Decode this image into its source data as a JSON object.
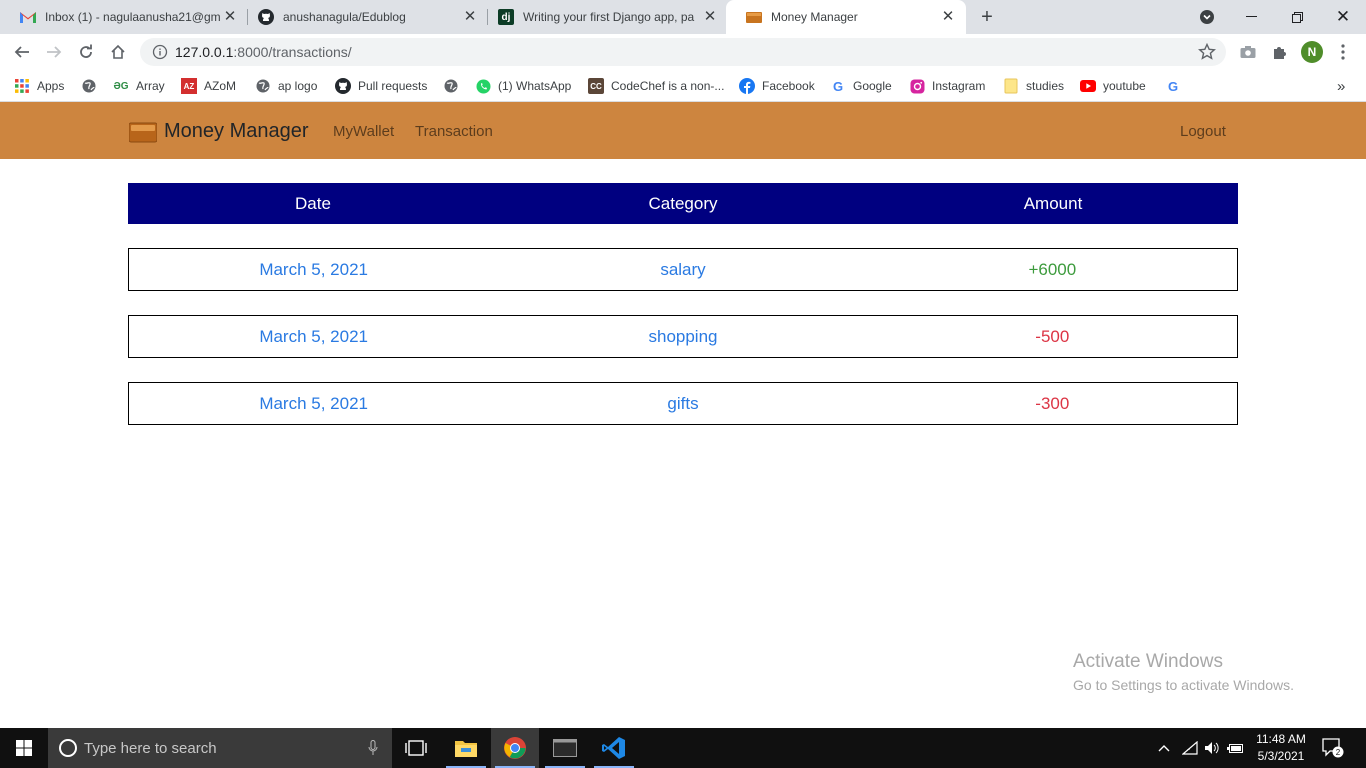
{
  "browser": {
    "tabs": [
      {
        "title": "Inbox (1) - nagulaanusha21@gm",
        "icon": "gmail-icon"
      },
      {
        "title": "anushanagula/Edublog",
        "icon": "github-icon"
      },
      {
        "title": "Writing your first Django app, pa",
        "icon": "django-icon"
      },
      {
        "title": "Money Manager",
        "icon": "wallet-icon",
        "active": true
      }
    ],
    "url_host": "127.0.0.1",
    "url_rest": ":8000/transactions/",
    "profile_initial": "N",
    "bookmarks": [
      {
        "label": "Apps",
        "icon": "apps-grid-icon"
      },
      {
        "label": "",
        "icon": "globe-icon"
      },
      {
        "label": "Array",
        "icon": "geeksforgeeks-icon"
      },
      {
        "label": "AZoM",
        "icon": "azom-icon"
      },
      {
        "label": "ap logo",
        "icon": "globe-icon"
      },
      {
        "label": "Pull requests",
        "icon": "github-icon"
      },
      {
        "label": "",
        "icon": "globe-icon"
      },
      {
        "label": "(1) WhatsApp",
        "icon": "whatsapp-icon"
      },
      {
        "label": "CodeChef is a non-...",
        "icon": "codechef-icon"
      },
      {
        "label": "Facebook",
        "icon": "facebook-icon"
      },
      {
        "label": "Google",
        "icon": "google-icon"
      },
      {
        "label": "Instagram",
        "icon": "instagram-icon"
      },
      {
        "label": "studies",
        "icon": "folder-icon"
      },
      {
        "label": "youtube",
        "icon": "youtube-icon"
      },
      {
        "label": "",
        "icon": "google-icon"
      }
    ],
    "more_bookmarks": "»"
  },
  "navbar": {
    "brand": "Money Manager",
    "links": [
      "MyWallet",
      "Transaction"
    ],
    "logout": "Logout",
    "bg_color": "#cd853f"
  },
  "table": {
    "headers": [
      "Date",
      "Category",
      "Amount"
    ],
    "header_bg": "#000080",
    "rows": [
      {
        "date": "March 5, 2021",
        "category": "salary",
        "amount": "+6000",
        "type": "income"
      },
      {
        "date": "March 5, 2021",
        "category": "shopping",
        "amount": "-500",
        "type": "expense"
      },
      {
        "date": "March 5, 2021",
        "category": "gifts",
        "amount": "-300",
        "type": "expense"
      }
    ],
    "colors": {
      "text": "#2a7ae2",
      "income": "#3d9b3d",
      "expense": "#dc3545"
    }
  },
  "watermark": {
    "line1": "Activate Windows",
    "line2": "Go to Settings to activate Windows."
  },
  "taskbar": {
    "search_placeholder": "Type here to search",
    "time": "11:48 AM",
    "date": "5/3/2021",
    "notifications": "2"
  }
}
